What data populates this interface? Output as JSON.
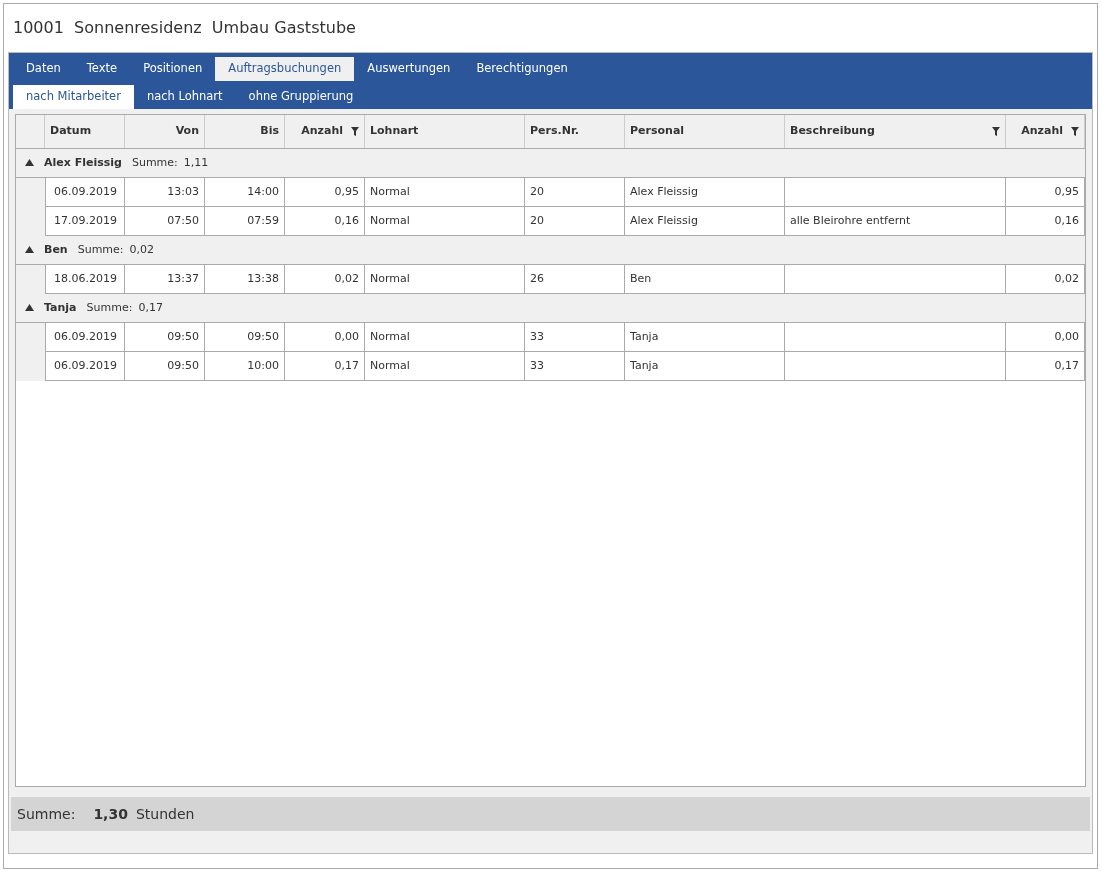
{
  "window": {
    "title": "10001  Sonnenresidenz  Umbau Gaststube"
  },
  "tabs": [
    {
      "label": "Daten",
      "selected": false
    },
    {
      "label": "Texte",
      "selected": false
    },
    {
      "label": "Positionen",
      "selected": false
    },
    {
      "label": "Auftragsbuchungen",
      "selected": true
    },
    {
      "label": "Auswertungen",
      "selected": false
    },
    {
      "label": "Berechtigungen",
      "selected": false
    }
  ],
  "subtabs": [
    {
      "label": "nach Mitarbeiter",
      "selected": true
    },
    {
      "label": "nach Lohnart",
      "selected": false
    },
    {
      "label": "ohne Gruppierung",
      "selected": false
    }
  ],
  "table": {
    "columns": [
      {
        "label": "Datum",
        "filter": false
      },
      {
        "label": "Von",
        "filter": false
      },
      {
        "label": "Bis",
        "filter": false
      },
      {
        "label": "Anzahl",
        "filter": true
      },
      {
        "label": "Lohnart",
        "filter": false
      },
      {
        "label": "Pers.Nr.",
        "filter": false
      },
      {
        "label": "Personal",
        "filter": false
      },
      {
        "label": "Beschreibung",
        "filter": true
      },
      {
        "label": "Anzahl",
        "filter": true
      }
    ],
    "groups": [
      {
        "name": "Alex Fleissig",
        "sum_label": "Summe:",
        "sum": "1,11",
        "expanded": true,
        "rows": [
          [
            "06.09.2019",
            "13:03",
            "14:00",
            "0,95",
            "Normal",
            "20",
            "Alex Fleissig",
            "",
            "0,95"
          ],
          [
            "17.09.2019",
            "07:50",
            "07:59",
            "0,16",
            "Normal",
            "20",
            "Alex Fleissig",
            "alle Bleirohre entfernt",
            "0,16"
          ]
        ]
      },
      {
        "name": "Ben",
        "sum_label": "Summe:",
        "sum": "0,02",
        "expanded": true,
        "rows": [
          [
            "18.06.2019",
            "13:37",
            "13:38",
            "0,02",
            "Normal",
            "26",
            "Ben",
            "",
            "0,02"
          ]
        ]
      },
      {
        "name": "Tanja",
        "sum_label": "Summe:",
        "sum": "0,17",
        "expanded": true,
        "rows": [
          [
            "06.09.2019",
            "09:50",
            "09:50",
            "0,00",
            "Normal",
            "33",
            "Tanja",
            "",
            "0,00"
          ],
          [
            "06.09.2019",
            "09:50",
            "10:00",
            "0,17",
            "Normal",
            "33",
            "Tanja",
            "",
            "0,17"
          ]
        ]
      }
    ]
  },
  "footer": {
    "label": "Summe:",
    "value": "1,30",
    "unit": "Stunden"
  }
}
